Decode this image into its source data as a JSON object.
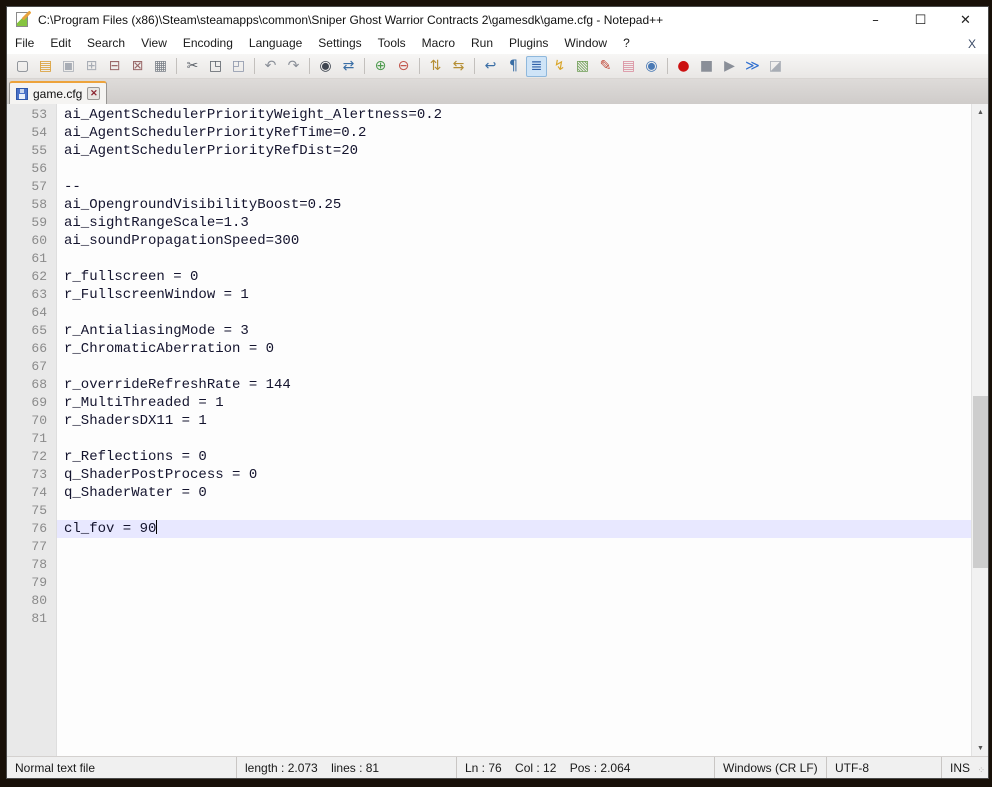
{
  "window": {
    "title": "C:\\Program Files (x86)\\Steam\\steamapps\\common\\Sniper Ghost Warrior Contracts 2\\gamesdk\\game.cfg - Notepad++",
    "controls": {
      "minimize": "–",
      "maximize": "☐",
      "close": "✕"
    }
  },
  "menu": {
    "items": [
      "File",
      "Edit",
      "Search",
      "View",
      "Encoding",
      "Language",
      "Settings",
      "Tools",
      "Macro",
      "Run",
      "Plugins",
      "Window",
      "?"
    ],
    "close_document": "X"
  },
  "toolbar": {
    "buttons": [
      {
        "name": "new-file",
        "glyph": "▢",
        "color": "#7a8088"
      },
      {
        "name": "open-file",
        "glyph": "▤",
        "color": "#d99a2b"
      },
      {
        "name": "save-file",
        "glyph": "▣",
        "color": "#a8adb5"
      },
      {
        "name": "save-all",
        "glyph": "⊞",
        "color": "#a8adb5"
      },
      {
        "name": "close-file",
        "glyph": "⊟",
        "color": "#9a6a6a"
      },
      {
        "name": "close-all",
        "glyph": "⊠",
        "color": "#9a6a6a"
      },
      {
        "name": "print",
        "glyph": "▦",
        "color": "#7a8088",
        "sep": true
      },
      {
        "name": "cut",
        "glyph": "✂",
        "color": "#5a6068"
      },
      {
        "name": "copy",
        "glyph": "◳",
        "color": "#5a6068"
      },
      {
        "name": "paste",
        "glyph": "◰",
        "color": "#8a93a8",
        "sep": true
      },
      {
        "name": "undo",
        "glyph": "↶",
        "color": "#8a8f98"
      },
      {
        "name": "redo",
        "glyph": "↷",
        "color": "#8a8f98",
        "sep": true
      },
      {
        "name": "find",
        "glyph": "◉",
        "color": "#3f4650"
      },
      {
        "name": "replace",
        "glyph": "⇄",
        "color": "#3a6ea5",
        "sep": true
      },
      {
        "name": "zoom-in",
        "glyph": "⊕",
        "color": "#4d9b4d"
      },
      {
        "name": "zoom-out",
        "glyph": "⊖",
        "color": "#c2574d",
        "sep": true
      },
      {
        "name": "sync-vertical-scroll",
        "glyph": "⇅",
        "color": "#b58f35"
      },
      {
        "name": "sync-horizontal-scroll",
        "glyph": "⇆",
        "color": "#b58f35",
        "sep": true
      },
      {
        "name": "word-wrap",
        "glyph": "↩",
        "color": "#3a6ea5"
      },
      {
        "name": "show-all-characters",
        "glyph": "¶",
        "color": "#3a6ea5"
      },
      {
        "name": "indent-guide",
        "glyph": "≣",
        "color": "#2f5fa8",
        "active": true
      },
      {
        "name": "function-list",
        "glyph": "↯",
        "color": "#d9a62b"
      },
      {
        "name": "document-map",
        "glyph": "▧",
        "color": "#6f9e55"
      },
      {
        "name": "define-language",
        "glyph": "✎",
        "color": "#c04a3a"
      },
      {
        "name": "folder-as-workspace",
        "glyph": "▤",
        "color": "#d98a9b"
      },
      {
        "name": "monitoring-eye",
        "glyph": "◉",
        "color": "#4a7ab5",
        "sep": true
      },
      {
        "name": "record-macro",
        "glyph": "●",
        "color": "#cc1111"
      },
      {
        "name": "stop-macro",
        "glyph": "■",
        "color": "#8a8f98"
      },
      {
        "name": "play-macro",
        "glyph": "▶",
        "color": "#8a8f98"
      },
      {
        "name": "run-macro-multiple",
        "glyph": "≫",
        "color": "#2f6fd0"
      },
      {
        "name": "save-macro",
        "glyph": "◪",
        "color": "#a8adb5"
      }
    ]
  },
  "tabs": [
    {
      "label": "game.cfg",
      "active": true
    }
  ],
  "editor": {
    "lines": [
      {
        "num": 53,
        "text": "ai_AgentSchedulerPriorityWeight_Alertness=0.2"
      },
      {
        "num": 54,
        "text": "ai_AgentSchedulerPriorityRefTime=0.2"
      },
      {
        "num": 55,
        "text": "ai_AgentSchedulerPriorityRefDist=20"
      },
      {
        "num": 56,
        "text": ""
      },
      {
        "num": 57,
        "text": "--"
      },
      {
        "num": 58,
        "text": "ai_OpengroundVisibilityBoost=0.25"
      },
      {
        "num": 59,
        "text": "ai_sightRangeScale=1.3"
      },
      {
        "num": 60,
        "text": "ai_soundPropagationSpeed=300"
      },
      {
        "num": 61,
        "text": ""
      },
      {
        "num": 62,
        "text": "r_fullscreen = 0"
      },
      {
        "num": 63,
        "text": "r_FullscreenWindow = 1"
      },
      {
        "num": 64,
        "text": ""
      },
      {
        "num": 65,
        "text": "r_AntialiasingMode = 3"
      },
      {
        "num": 66,
        "text": "r_ChromaticAberration = 0"
      },
      {
        "num": 67,
        "text": ""
      },
      {
        "num": 68,
        "text": "r_overrideRefreshRate = 144"
      },
      {
        "num": 69,
        "text": "r_MultiThreaded = 1"
      },
      {
        "num": 70,
        "text": "r_ShadersDX11 = 1"
      },
      {
        "num": 71,
        "text": ""
      },
      {
        "num": 72,
        "text": "r_Reflections = 0"
      },
      {
        "num": 73,
        "text": "q_ShaderPostProcess = 0"
      },
      {
        "num": 74,
        "text": "q_ShaderWater = 0"
      },
      {
        "num": 75,
        "text": ""
      },
      {
        "num": 76,
        "text": "cl_fov = 90",
        "current": true
      },
      {
        "num": 77,
        "text": ""
      },
      {
        "num": 78,
        "text": ""
      },
      {
        "num": 79,
        "text": ""
      },
      {
        "num": 80,
        "text": ""
      },
      {
        "num": 81,
        "text": ""
      }
    ]
  },
  "statusbar": {
    "sections": [
      {
        "name": "doc-type",
        "text": "Normal text file",
        "interactable": false
      },
      {
        "name": "length-lines",
        "text": "length : 2.073    lines : 81",
        "interactable": false
      },
      {
        "name": "caret-position",
        "text": "Ln : 76    Col : 12    Pos : 2.064",
        "interactable": false
      },
      {
        "name": "eol-format",
        "text": "Windows (CR LF)",
        "interactable": true
      },
      {
        "name": "encoding",
        "text": "UTF-8",
        "interactable": true
      },
      {
        "name": "insert-mode",
        "text": "INS",
        "interactable": true
      }
    ]
  }
}
